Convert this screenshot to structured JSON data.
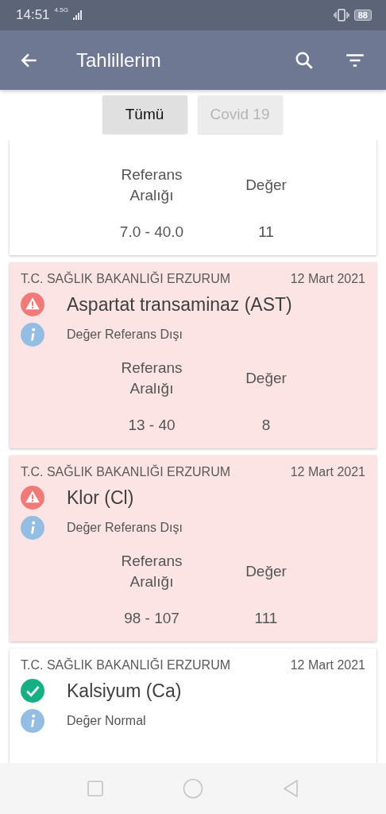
{
  "status_bar": {
    "time": "14:51",
    "network": "4.5G",
    "battery": "88"
  },
  "app_bar": {
    "title": "Tahlillerim"
  },
  "tabs": [
    {
      "label": "Tümü",
      "selected": true
    },
    {
      "label": "Covid 19",
      "selected": false
    }
  ],
  "results": [
    {
      "kind": "normal",
      "reference_label": "Referans Aralığı",
      "value_label": "Değer",
      "reference": "7.0 - 40.0",
      "value": "11"
    },
    {
      "kind": "abnormal",
      "institution": "T.C. SAĞLIK BAKANLIĞI ERZURUM",
      "date": "12 Mart 2021",
      "test": "Aspartat transaminaz (AST)",
      "status": "Değer Referans Dışı",
      "reference_label": "Referans Aralığı",
      "value_label": "Değer",
      "reference": "13 - 40",
      "value": "8"
    },
    {
      "kind": "abnormal",
      "institution": "T.C. SAĞLIK BAKANLIĞI ERZURUM",
      "date": "12 Mart 2021",
      "test": "Klor (Cl)",
      "status": "Değer Referans Dışı",
      "reference_label": "Referans Aralığı",
      "value_label": "Değer",
      "reference": "98 - 107",
      "value": "111"
    },
    {
      "kind": "normal",
      "institution": "T.C. SAĞLIK BAKANLIĞI ERZURUM",
      "date": "12 Mart 2021",
      "test": "Kalsiyum (Ca)",
      "status": "Değer Normal"
    }
  ]
}
